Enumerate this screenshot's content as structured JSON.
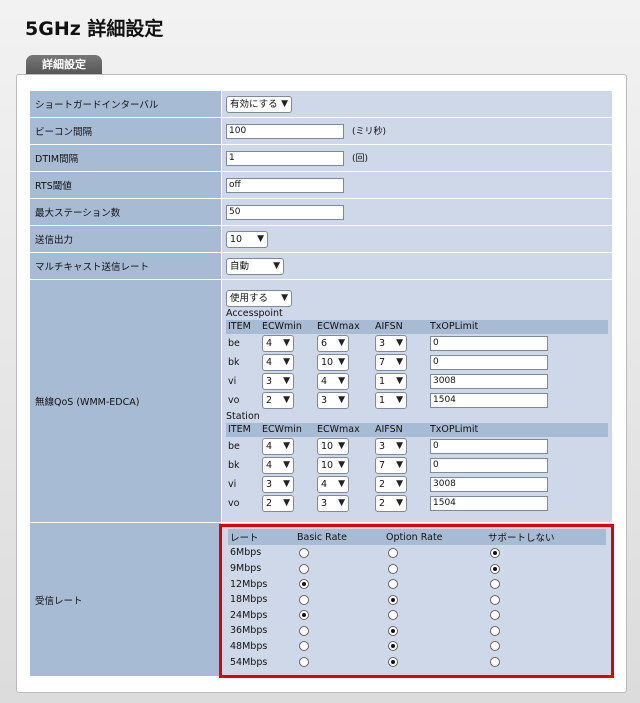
{
  "page_title": "5GHz 詳細設定",
  "tab_label": "詳細設定",
  "settings": {
    "short_guard": {
      "label": "ショートガードインターバル",
      "value": "有効にする"
    },
    "beacon": {
      "label": "ビーコン間隔",
      "value": "100",
      "unit": "(ミリ秒)"
    },
    "dtim": {
      "label": "DTIM間隔",
      "value": "1",
      "unit": "(回)"
    },
    "rts": {
      "label": "RTS閾値",
      "value": "off"
    },
    "max_station": {
      "label": "最大ステーション数",
      "value": "50"
    },
    "tx_power": {
      "label": "送信出力",
      "value": "10"
    },
    "multicast": {
      "label": "マルチキャスト送信レート",
      "value": "自動"
    }
  },
  "qos": {
    "label": "無線QoS (WMM-EDCA)",
    "enable": "使用する",
    "columns": [
      "ITEM",
      "ECWmin",
      "ECWmax",
      "AIFSN",
      "TxOPLimit"
    ],
    "accesspoint": {
      "title": "Accesspoint",
      "rows": [
        {
          "item": "be",
          "ecwmin": "4",
          "ecwmax": "6",
          "aifsn": "3",
          "txop": "0"
        },
        {
          "item": "bk",
          "ecwmin": "4",
          "ecwmax": "10",
          "aifsn": "7",
          "txop": "0"
        },
        {
          "item": "vi",
          "ecwmin": "3",
          "ecwmax": "4",
          "aifsn": "1",
          "txop": "3008"
        },
        {
          "item": "vo",
          "ecwmin": "2",
          "ecwmax": "3",
          "aifsn": "1",
          "txop": "1504"
        }
      ]
    },
    "station": {
      "title": "Station",
      "rows": [
        {
          "item": "be",
          "ecwmin": "4",
          "ecwmax": "10",
          "aifsn": "3",
          "txop": "0"
        },
        {
          "item": "bk",
          "ecwmin": "4",
          "ecwmax": "10",
          "aifsn": "7",
          "txop": "0"
        },
        {
          "item": "vi",
          "ecwmin": "3",
          "ecwmax": "4",
          "aifsn": "2",
          "txop": "3008"
        },
        {
          "item": "vo",
          "ecwmin": "2",
          "ecwmax": "3",
          "aifsn": "2",
          "txop": "1504"
        }
      ]
    }
  },
  "rx_rate": {
    "label": "受信レート",
    "columns": [
      "レート",
      "Basic Rate",
      "Option Rate",
      "サポートしない"
    ],
    "rows": [
      {
        "rate": "6Mbps",
        "selected": 3
      },
      {
        "rate": "9Mbps",
        "selected": 3
      },
      {
        "rate": "12Mbps",
        "selected": 1
      },
      {
        "rate": "18Mbps",
        "selected": 2
      },
      {
        "rate": "24Mbps",
        "selected": 1
      },
      {
        "rate": "36Mbps",
        "selected": 2
      },
      {
        "rate": "48Mbps",
        "selected": 2
      },
      {
        "rate": "54Mbps",
        "selected": 2
      }
    ]
  }
}
